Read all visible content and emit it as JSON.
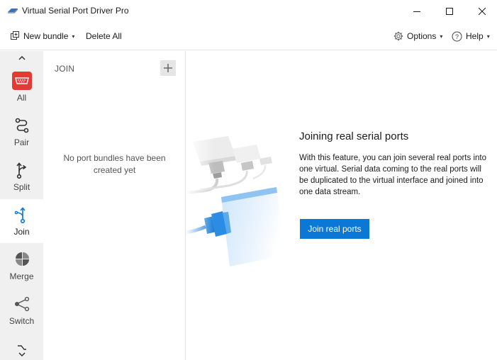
{
  "window": {
    "title": "Virtual Serial Port Driver Pro"
  },
  "toolbar": {
    "new_bundle": "New bundle",
    "delete_all": "Delete All",
    "options": "Options",
    "help": "Help"
  },
  "nav": {
    "items": [
      {
        "label": "All",
        "icon": "serial-port-icon"
      },
      {
        "label": "Pair",
        "icon": "pair-icon"
      },
      {
        "label": "Split",
        "icon": "split-icon"
      },
      {
        "label": "Join",
        "icon": "join-icon",
        "active": true
      },
      {
        "label": "Merge",
        "icon": "merge-icon"
      },
      {
        "label": "Switch",
        "icon": "switch-icon"
      }
    ]
  },
  "list": {
    "header": "JOIN",
    "empty_message": "No port bundles have been created yet"
  },
  "feature": {
    "title": "Joining real serial ports",
    "description": "With this feature, you can join several real ports into one virtual. Serial data coming to the real ports will be duplicated to the virtual interface and joined into one data stream.",
    "button": "Join real ports"
  },
  "colors": {
    "accent": "#0a78d4",
    "all_icon": "#e53935",
    "nav_bg": "#f0f0f0"
  }
}
